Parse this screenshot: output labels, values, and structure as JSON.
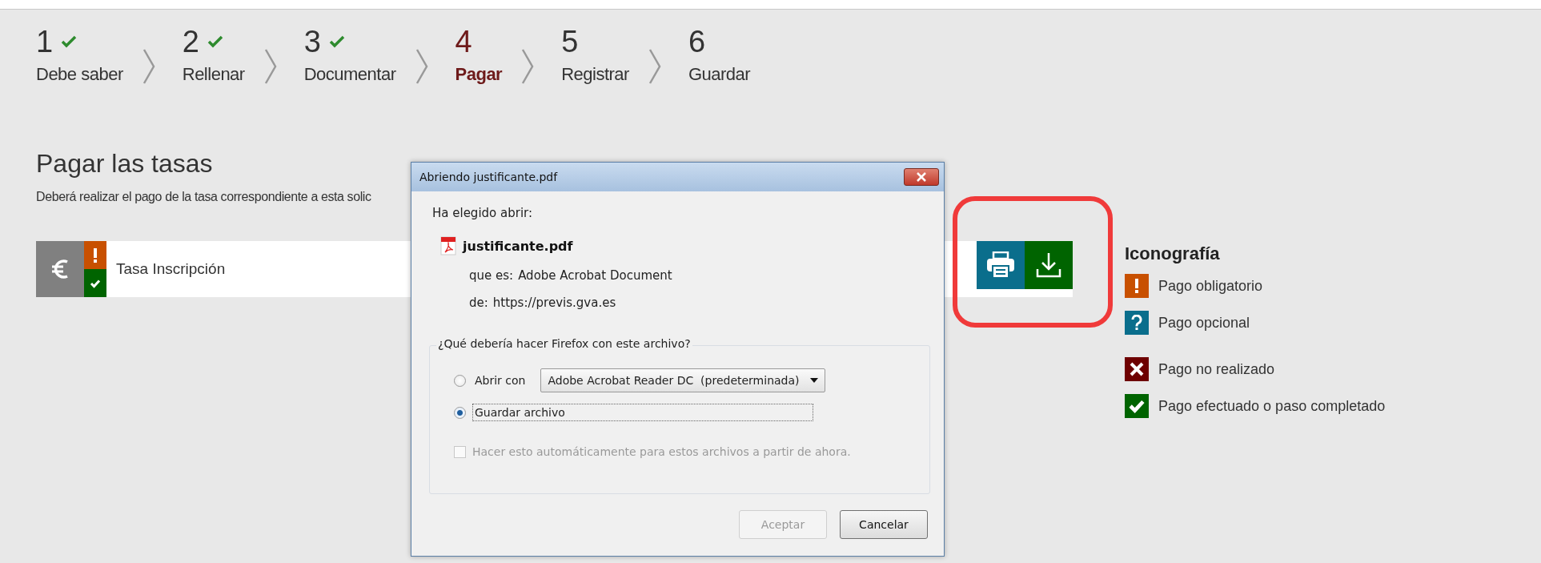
{
  "steps": [
    {
      "number": "1",
      "label": "Debe saber",
      "completed": true,
      "selected": false
    },
    {
      "number": "2",
      "label": "Rellenar",
      "completed": true,
      "selected": false
    },
    {
      "number": "3",
      "label": "Documentar",
      "completed": true,
      "selected": false
    },
    {
      "number": "4",
      "label": "Pagar",
      "completed": false,
      "selected": true
    },
    {
      "number": "5",
      "label": "Registrar",
      "completed": false,
      "selected": false
    },
    {
      "number": "6",
      "label": "Guardar",
      "completed": false,
      "selected": false
    }
  ],
  "section": {
    "title": "Pagar las tasas",
    "description": "Deberá realizar el pago de la tasa correspondiente a esta solic"
  },
  "fees": [
    {
      "name": "Tasa Inscripción",
      "mandatory": true,
      "paid": true
    }
  ],
  "legend": {
    "title": "Iconografía",
    "items": [
      {
        "kind": "mandatory",
        "color": "#c85000",
        "label": "Pago obligatorio"
      },
      {
        "kind": "optional",
        "color": "#0a6e8c",
        "label": "Pago opcional"
      },
      {
        "kind": "unpaid",
        "color": "#6e0000",
        "label": "Pago no realizado"
      },
      {
        "kind": "paid",
        "color": "#006400",
        "label": "Pago efectuado o paso completado"
      }
    ]
  },
  "dialog": {
    "title": "Abriendo justificante.pdf",
    "intro": "Ha elegido abrir:",
    "file_name": "justificante.pdf",
    "type_label": "que es:",
    "type_value": "Adobe Acrobat Document",
    "from_label": "de:",
    "from_value": "https://previs.gva.es",
    "question": "¿Qué debería hacer Firefox con este archivo?",
    "options": [
      {
        "kind": "open",
        "label": "Abrir con",
        "selected": false,
        "app": "Adobe Acrobat Reader DC  (predeterminada)"
      },
      {
        "kind": "save",
        "label": "Guardar archivo",
        "selected": true
      }
    ],
    "auto": {
      "label": "Hacer esto automáticamente para estos archivos a partir de ahora.",
      "checked": false,
      "disabled": true
    },
    "buttons": [
      {
        "label": "Aceptar",
        "disabled": true
      },
      {
        "label": "Cancelar",
        "disabled": false
      }
    ]
  }
}
